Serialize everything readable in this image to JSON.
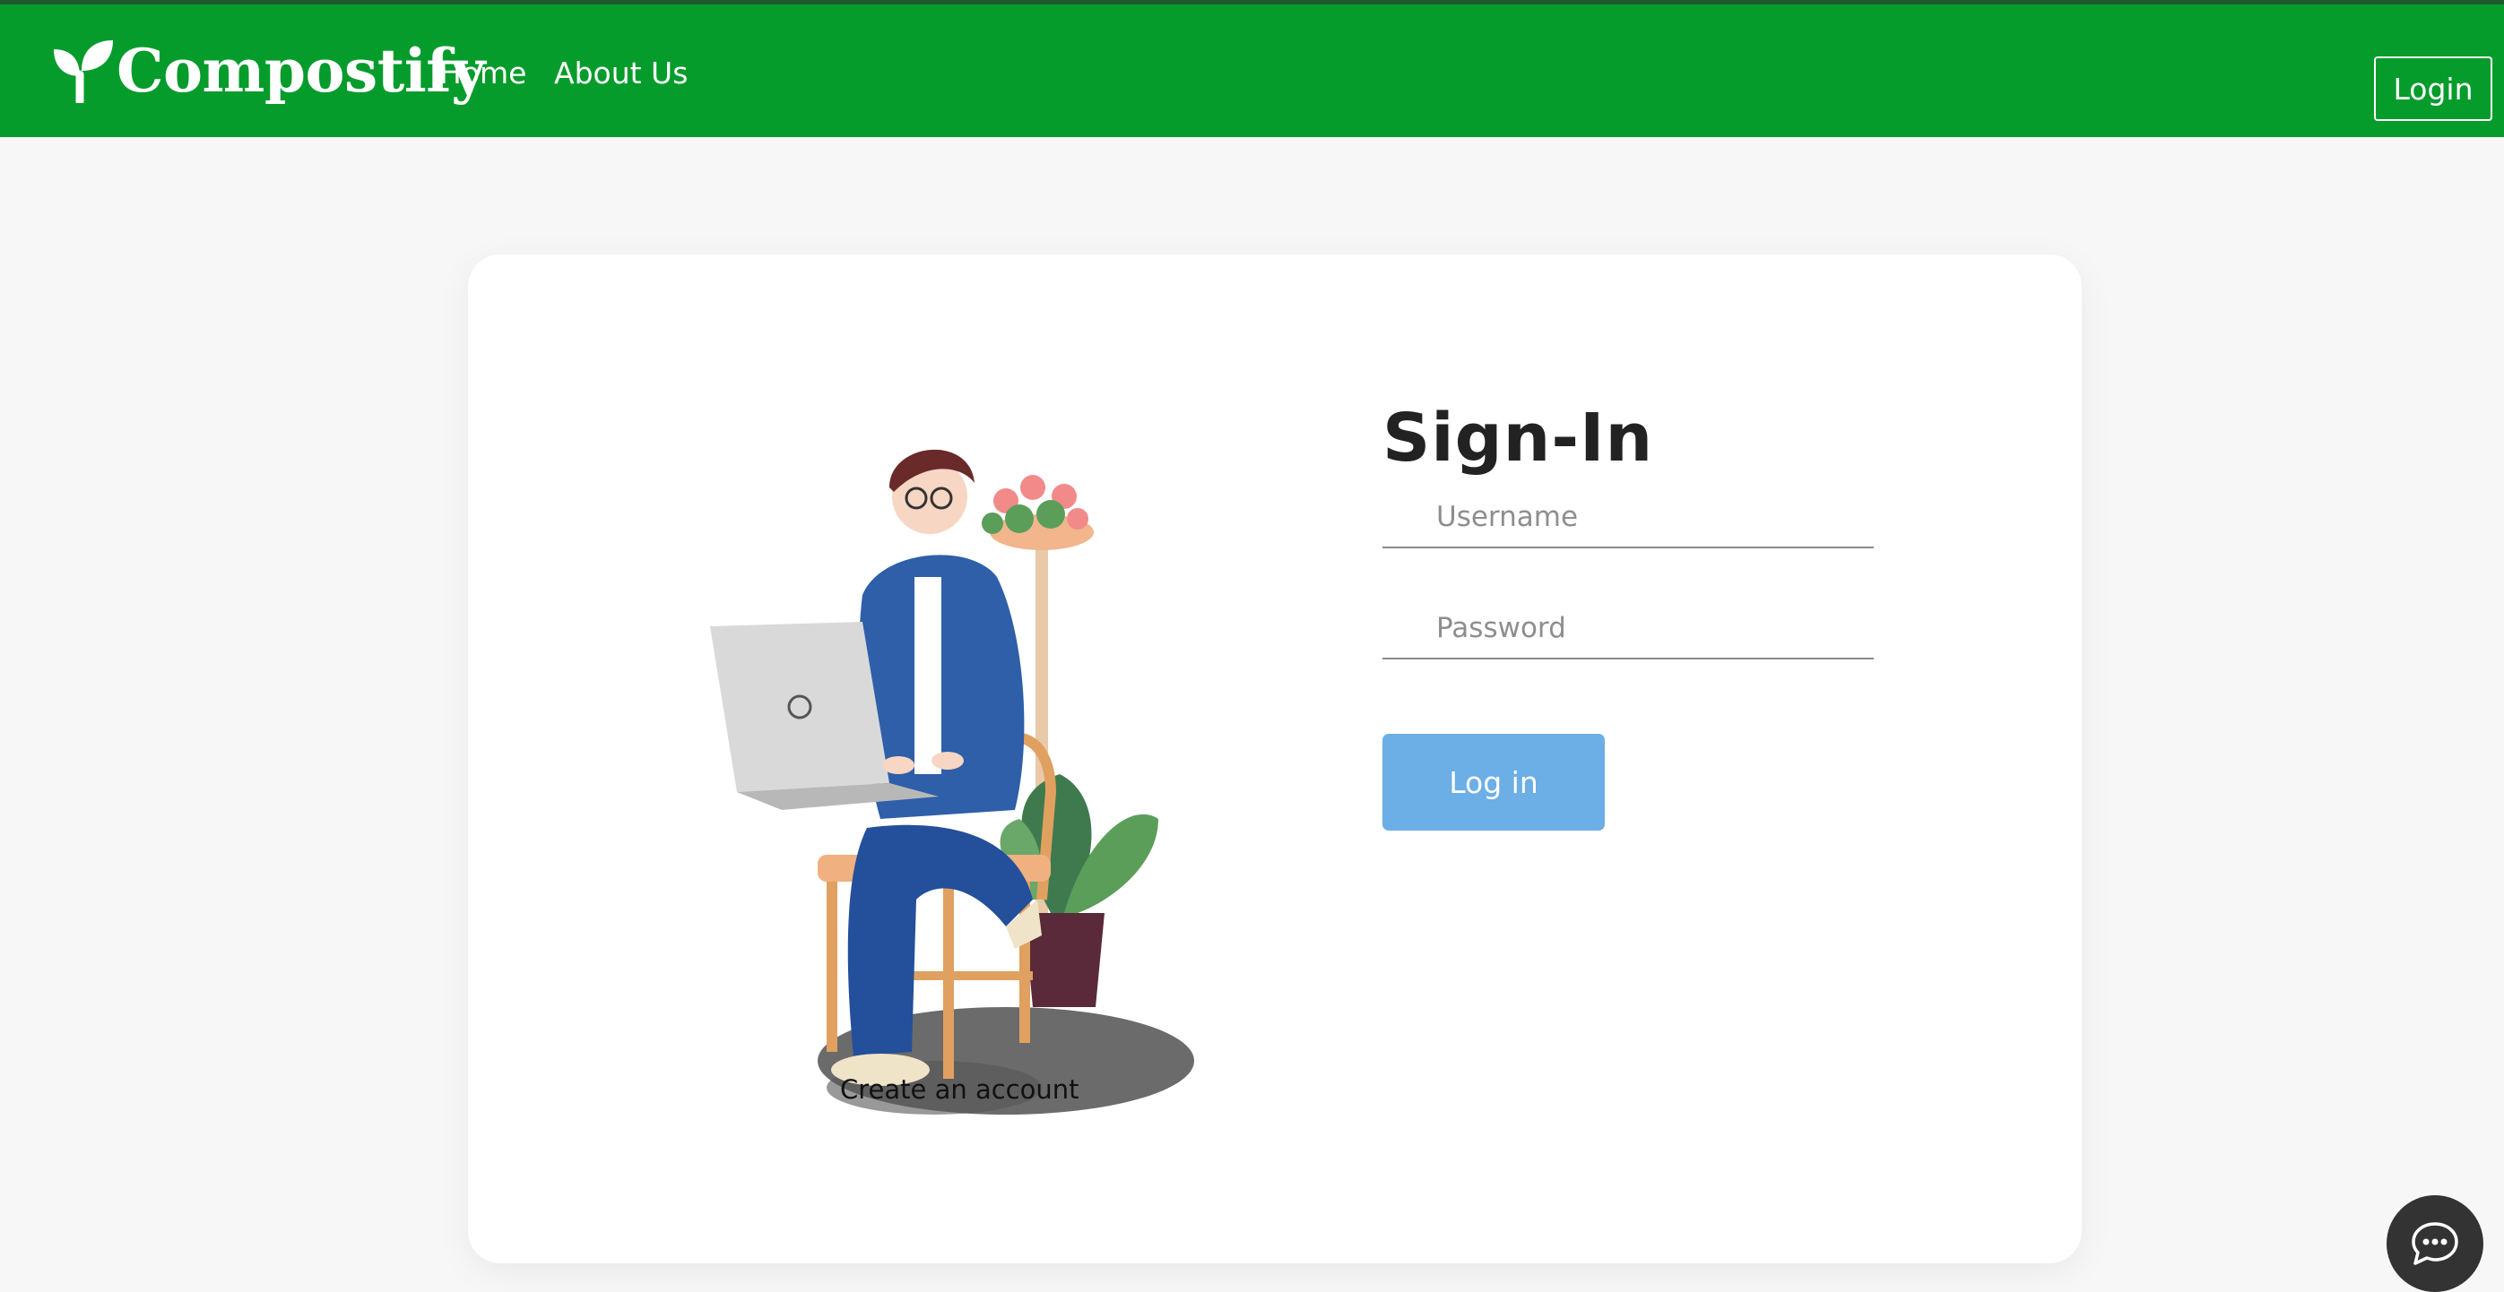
{
  "header": {
    "brand_name": "Compostify",
    "brand_icon": "sprout-icon",
    "nav": [
      {
        "label": "Home"
      },
      {
        "label": "About Us"
      }
    ],
    "login_label": "Login",
    "colors": {
      "navbar": "#069c2c",
      "top_strip": "#1f5a2e"
    }
  },
  "signin": {
    "title": "Sign-In",
    "username_placeholder": "Username",
    "password_placeholder": "Password",
    "submit_label": "Log in",
    "submit_color": "#6caee6"
  },
  "illustration": {
    "icon": "person-with-laptop-illustration"
  },
  "create_account_label": "Create an account",
  "chat": {
    "icon": "chat-bubble-icon",
    "color": "#333333"
  }
}
